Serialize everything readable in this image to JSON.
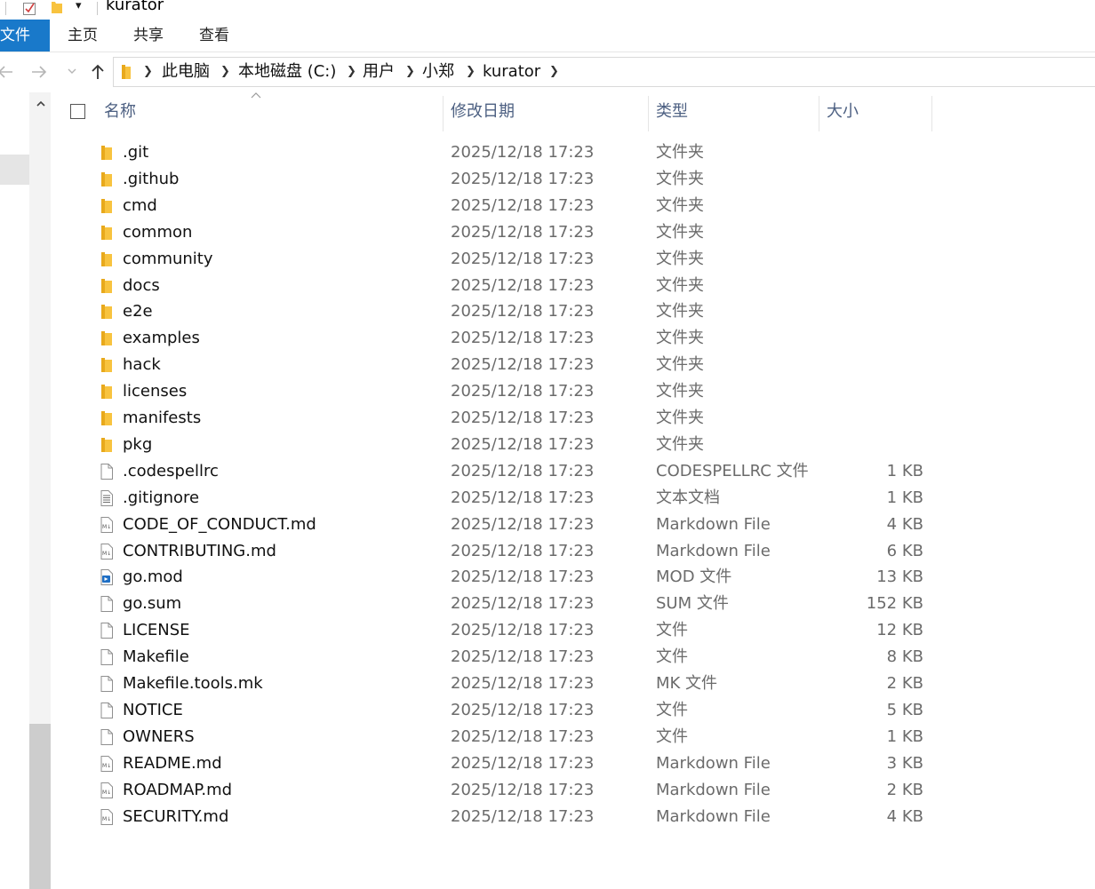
{
  "window": {
    "title": "kurator",
    "quick_access_dropdown": "▾"
  },
  "ribbon": {
    "tabs": [
      "文件",
      "主页",
      "共享",
      "查看"
    ]
  },
  "address": {
    "crumbs": [
      "此电脑",
      "本地磁盘 (C:)",
      "用户",
      "小郑",
      "kurator"
    ]
  },
  "columns": {
    "name": "名称",
    "date": "修改日期",
    "type": "类型",
    "size": "大小"
  },
  "rows": [
    {
      "name": ".git",
      "date": "2025/12/18 17:23",
      "type": "文件夹",
      "size": "",
      "icon": "folder-icon"
    },
    {
      "name": ".github",
      "date": "2025/12/18 17:23",
      "type": "文件夹",
      "size": "",
      "icon": "folder-icon"
    },
    {
      "name": "cmd",
      "date": "2025/12/18 17:23",
      "type": "文件夹",
      "size": "",
      "icon": "folder-icon"
    },
    {
      "name": "common",
      "date": "2025/12/18 17:23",
      "type": "文件夹",
      "size": "",
      "icon": "folder-icon"
    },
    {
      "name": "community",
      "date": "2025/12/18 17:23",
      "type": "文件夹",
      "size": "",
      "icon": "folder-icon"
    },
    {
      "name": "docs",
      "date": "2025/12/18 17:23",
      "type": "文件夹",
      "size": "",
      "icon": "folder-icon"
    },
    {
      "name": "e2e",
      "date": "2025/12/18 17:23",
      "type": "文件夹",
      "size": "",
      "icon": "folder-icon"
    },
    {
      "name": "examples",
      "date": "2025/12/18 17:23",
      "type": "文件夹",
      "size": "",
      "icon": "folder-icon"
    },
    {
      "name": "hack",
      "date": "2025/12/18 17:23",
      "type": "文件夹",
      "size": "",
      "icon": "folder-icon"
    },
    {
      "name": "licenses",
      "date": "2025/12/18 17:23",
      "type": "文件夹",
      "size": "",
      "icon": "folder-icon"
    },
    {
      "name": "manifests",
      "date": "2025/12/18 17:23",
      "type": "文件夹",
      "size": "",
      "icon": "folder-icon"
    },
    {
      "name": "pkg",
      "date": "2025/12/18 17:23",
      "type": "文件夹",
      "size": "",
      "icon": "folder-icon"
    },
    {
      "name": ".codespellrc",
      "date": "2025/12/18 17:23",
      "type": "CODESPELLRC 文件",
      "size": "1 KB",
      "icon": "file-icon"
    },
    {
      "name": ".gitignore",
      "date": "2025/12/18 17:23",
      "type": "文本文档",
      "size": "1 KB",
      "icon": "text-file-icon"
    },
    {
      "name": "CODE_OF_CONDUCT.md",
      "date": "2025/12/18 17:23",
      "type": "Markdown File",
      "size": "4 KB",
      "icon": "markdown-file-icon"
    },
    {
      "name": "CONTRIBUTING.md",
      "date": "2025/12/18 17:23",
      "type": "Markdown File",
      "size": "6 KB",
      "icon": "markdown-file-icon"
    },
    {
      "name": "go.mod",
      "date": "2025/12/18 17:23",
      "type": "MOD 文件",
      "size": "13 KB",
      "icon": "mod-file-icon"
    },
    {
      "name": "go.sum",
      "date": "2025/12/18 17:23",
      "type": "SUM 文件",
      "size": "152 KB",
      "icon": "file-icon"
    },
    {
      "name": "LICENSE",
      "date": "2025/12/18 17:23",
      "type": "文件",
      "size": "12 KB",
      "icon": "file-icon"
    },
    {
      "name": "Makefile",
      "date": "2025/12/18 17:23",
      "type": "文件",
      "size": "8 KB",
      "icon": "file-icon"
    },
    {
      "name": "Makefile.tools.mk",
      "date": "2025/12/18 17:23",
      "type": "MK 文件",
      "size": "2 KB",
      "icon": "file-icon"
    },
    {
      "name": "NOTICE",
      "date": "2025/12/18 17:23",
      "type": "文件",
      "size": "5 KB",
      "icon": "file-icon"
    },
    {
      "name": "OWNERS",
      "date": "2025/12/18 17:23",
      "type": "文件",
      "size": "1 KB",
      "icon": "file-icon"
    },
    {
      "name": "README.md",
      "date": "2025/12/18 17:23",
      "type": "Markdown File",
      "size": "3 KB",
      "icon": "markdown-file-icon"
    },
    {
      "name": "ROADMAP.md",
      "date": "2025/12/18 17:23",
      "type": "Markdown File",
      "size": "2 KB",
      "icon": "markdown-file-icon"
    },
    {
      "name": "SECURITY.md",
      "date": "2025/12/18 17:23",
      "type": "Markdown File",
      "size": "4 KB",
      "icon": "markdown-file-icon"
    }
  ],
  "colors": {
    "file_tab": "#1979ca",
    "folder": "#f8c33f",
    "header_text": "#4d6082"
  }
}
